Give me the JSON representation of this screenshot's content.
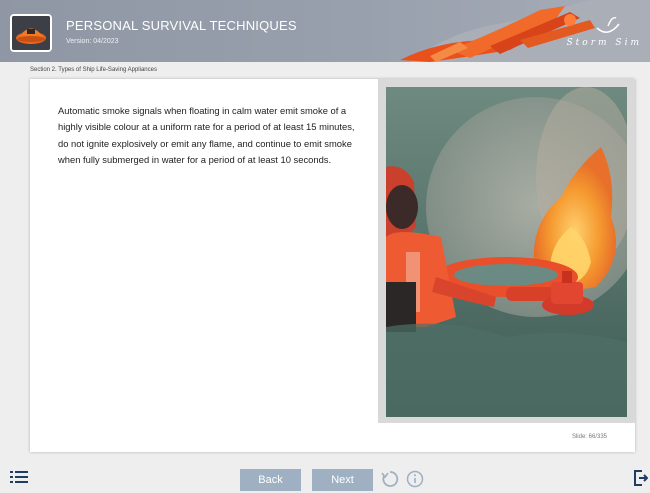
{
  "header": {
    "title": "PERSONAL SURVIVAL TECHNIQUES",
    "version": "Version: 04/2023",
    "brand": "Storm Sim",
    "logo_icon": "liferaft-icon",
    "colors": {
      "header_bg": "#98a0ad",
      "accent": "#e85a1c"
    }
  },
  "breadcrumb": "Section 2. Types of Ship Life-Saving Appliances",
  "content": {
    "text": "Automatic smoke signals when floating in calm water emit smoke of a highly visible colour at a uniform rate for a period of at least 15 minutes, do not ignite explosively or emit any flame, and continue to emit smoke when fully submerged in water for a period of at least 10 seconds.",
    "image": "smoke-signal-photo"
  },
  "slide_counter": "Slide: 66/335",
  "footer": {
    "back_label": "Back",
    "next_label": "Next",
    "menu_icon": "list-menu-icon",
    "reload_icon": "reload-icon",
    "info_icon": "info-icon",
    "exit_icon": "exit-icon",
    "button_color": "#9fb0c3"
  }
}
